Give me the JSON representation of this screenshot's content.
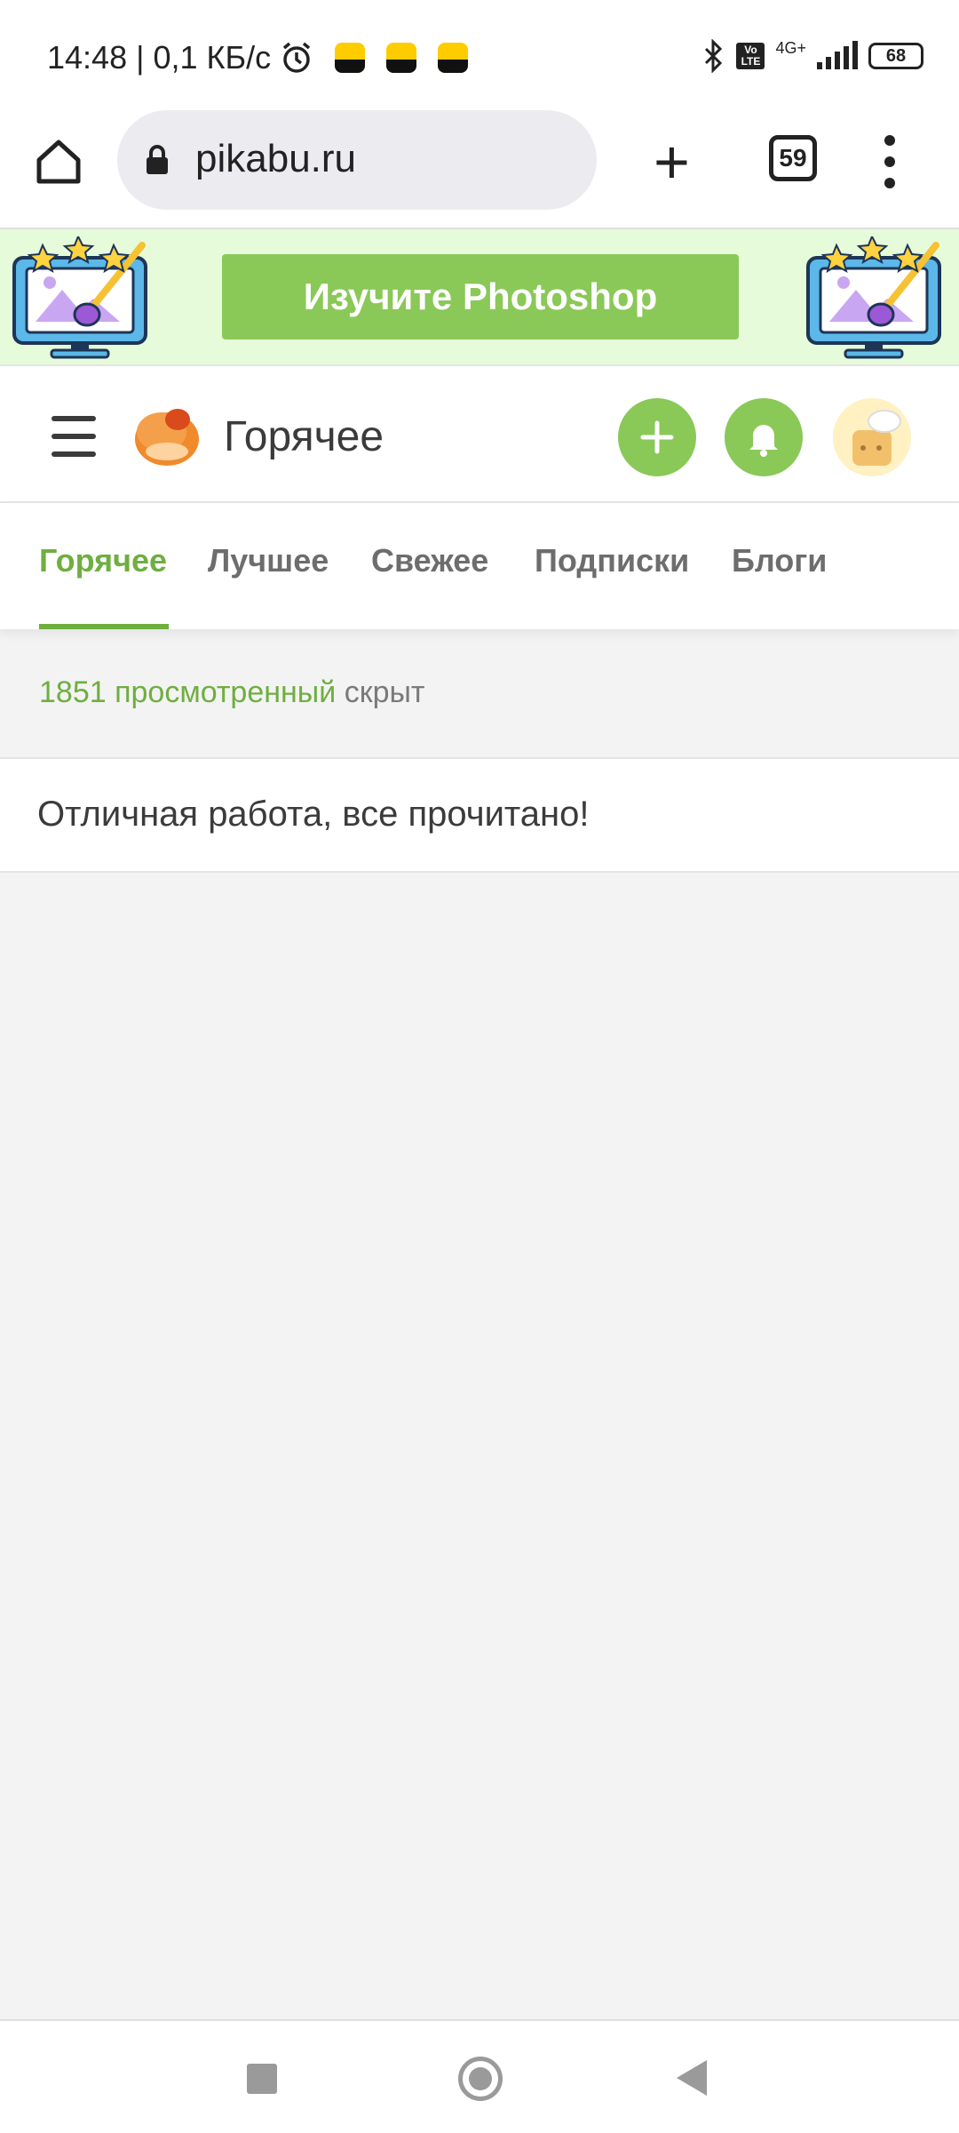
{
  "status_bar": {
    "time": "14:48",
    "net_speed": "| 0,1 КБ/с",
    "alarm_icon": "alarm-icon",
    "notification_icons": [
      "yellow-app-icon",
      "yellow-app-icon",
      "yellow-app-icon"
    ],
    "network_type": "4G+",
    "volte": "Vo LTE",
    "battery_level": "68"
  },
  "browser": {
    "url": "pikabu.ru",
    "tab_count": "59"
  },
  "promo": {
    "button_label": "Изучите Photoshop",
    "colors": {
      "background": "#e6fbd9",
      "button": "#8ac858"
    }
  },
  "header": {
    "title": "Горячее"
  },
  "tabs": [
    {
      "label": "Горячее",
      "active": true
    },
    {
      "label": "Лучшее",
      "active": false
    },
    {
      "label": "Свежее",
      "active": false
    },
    {
      "label": "Подписки",
      "active": false
    },
    {
      "label": "Блоги",
      "active": false
    }
  ],
  "feed": {
    "hidden_count_text": "1851 просмотренный",
    "hidden_suffix": "скрыт",
    "done_message": "Отличная работа, все прочитано!"
  },
  "accent_color": "#6fae40"
}
